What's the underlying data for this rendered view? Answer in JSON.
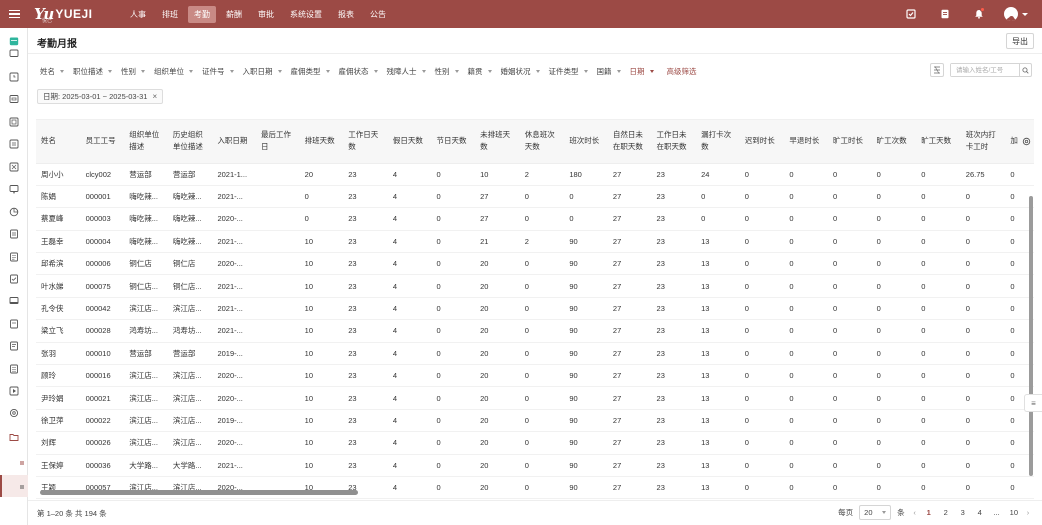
{
  "topbar": {
    "logo_mark": "Yu",
    "logo_text": "YUEJI",
    "logo_sub": "悦己",
    "nav": [
      {
        "label": "人事",
        "active": false
      },
      {
        "label": "排班",
        "active": false
      },
      {
        "label": "考勤",
        "active": true
      },
      {
        "label": "薪酬",
        "active": false
      },
      {
        "label": "审批",
        "active": false
      },
      {
        "label": "系统设置",
        "active": false
      },
      {
        "label": "报表",
        "active": false
      },
      {
        "label": "公告",
        "active": false
      }
    ],
    "accent": "#9c4a45"
  },
  "page": {
    "title": "考勤月报",
    "export_label": "导出"
  },
  "filters": {
    "items": [
      "姓名",
      "职位描述",
      "性别",
      "组织单位",
      "证件号",
      "入职日期",
      "雇佣类型",
      "雇佣状态",
      "残障人士",
      "性别",
      "籍贯",
      "婚姻状况",
      "证件类型",
      "国籍",
      "日期"
    ],
    "active_index": 14,
    "advanced_label": "高级筛选",
    "search_placeholder": "请输入姓名/工号"
  },
  "active_tag": "日期: 2025-03-01 ~ 2025-03-31",
  "table": {
    "columns": [
      "姓名",
      "员工工号",
      "组织单位描述",
      "历史组织单位描述",
      "入职日期",
      "最后工作日",
      "排班天数",
      "工作日天数",
      "假日天数",
      "节日天数",
      "未排班天数",
      "休息班次天数",
      "班次时长",
      "自然日未在职天数",
      "工作日未在职天数",
      "漏打卡次数",
      "迟到时长",
      "早退时长",
      "旷工时长",
      "旷工次数",
      "旷工天数",
      "班次内打卡工时",
      "加"
    ],
    "rows": [
      [
        "周小小",
        "clcy002",
        "营运部",
        "营运部",
        "2021-1...",
        "",
        "20",
        "23",
        "4",
        "0",
        "10",
        "2",
        "180",
        "27",
        "23",
        "24",
        "0",
        "0",
        "0",
        "0",
        "0",
        "26.75",
        "0"
      ],
      [
        "陈娟",
        "000001",
        "嗨吃辣...",
        "嗨吃辣...",
        "2021-...",
        "",
        "0",
        "23",
        "4",
        "0",
        "27",
        "0",
        "0",
        "27",
        "23",
        "0",
        "0",
        "0",
        "0",
        "0",
        "0",
        "0",
        "0"
      ],
      [
        "蔡夏峰",
        "000003",
        "嗨吃辣...",
        "嗨吃辣...",
        "2020-...",
        "",
        "0",
        "23",
        "4",
        "0",
        "27",
        "0",
        "0",
        "27",
        "23",
        "0",
        "0",
        "0",
        "0",
        "0",
        "0",
        "0",
        "0"
      ],
      [
        "王磊幸",
        "000004",
        "嗨吃辣...",
        "嗨吃辣...",
        "2021-...",
        "",
        "10",
        "23",
        "4",
        "0",
        "21",
        "2",
        "90",
        "27",
        "23",
        "13",
        "0",
        "0",
        "0",
        "0",
        "0",
        "0",
        "0"
      ],
      [
        "邱希滨",
        "000006",
        "铜仁店",
        "铜仁店",
        "2020-...",
        "",
        "10",
        "23",
        "4",
        "0",
        "20",
        "0",
        "90",
        "27",
        "23",
        "13",
        "0",
        "0",
        "0",
        "0",
        "0",
        "0",
        "0"
      ],
      [
        "叶水娣",
        "000075",
        "铜仁店...",
        "铜仁店...",
        "2021-...",
        "",
        "10",
        "23",
        "4",
        "0",
        "20",
        "0",
        "90",
        "27",
        "23",
        "13",
        "0",
        "0",
        "0",
        "0",
        "0",
        "0",
        "0"
      ],
      [
        "孔令侠",
        "000042",
        "滨江店...",
        "滨江店...",
        "2021-...",
        "",
        "10",
        "23",
        "4",
        "0",
        "20",
        "0",
        "90",
        "27",
        "23",
        "13",
        "0",
        "0",
        "0",
        "0",
        "0",
        "0",
        "0"
      ],
      [
        "梁立飞",
        "000028",
        "鸿寿坊...",
        "鸿寿坊...",
        "2021-...",
        "",
        "10",
        "23",
        "4",
        "0",
        "20",
        "0",
        "90",
        "27",
        "23",
        "13",
        "0",
        "0",
        "0",
        "0",
        "0",
        "0",
        "0"
      ],
      [
        "张羽",
        "000010",
        "营运部",
        "营运部",
        "2019-...",
        "",
        "10",
        "23",
        "4",
        "0",
        "20",
        "0",
        "90",
        "27",
        "23",
        "13",
        "0",
        "0",
        "0",
        "0",
        "0",
        "0",
        "0"
      ],
      [
        "顾玲",
        "000016",
        "滨江店...",
        "滨江店...",
        "2020-...",
        "",
        "10",
        "23",
        "4",
        "0",
        "20",
        "0",
        "90",
        "27",
        "23",
        "13",
        "0",
        "0",
        "0",
        "0",
        "0",
        "0",
        "0"
      ],
      [
        "尹玲娟",
        "000021",
        "滨江店...",
        "滨江店...",
        "2020-...",
        "",
        "10",
        "23",
        "4",
        "0",
        "20",
        "0",
        "90",
        "27",
        "23",
        "13",
        "0",
        "0",
        "0",
        "0",
        "0",
        "0",
        "0"
      ],
      [
        "徐卫萍",
        "000022",
        "滨江店...",
        "滨江店...",
        "2019-...",
        "",
        "10",
        "23",
        "4",
        "0",
        "20",
        "0",
        "90",
        "27",
        "23",
        "13",
        "0",
        "0",
        "0",
        "0",
        "0",
        "0",
        "0"
      ],
      [
        "刘辉",
        "000026",
        "滨江店...",
        "滨江店...",
        "2020-...",
        "",
        "10",
        "23",
        "4",
        "0",
        "20",
        "0",
        "90",
        "27",
        "23",
        "13",
        "0",
        "0",
        "0",
        "0",
        "0",
        "0",
        "0"
      ],
      [
        "王保婷",
        "000036",
        "大学路...",
        "大学路...",
        "2021-...",
        "",
        "10",
        "23",
        "4",
        "0",
        "20",
        "0",
        "90",
        "27",
        "23",
        "13",
        "0",
        "0",
        "0",
        "0",
        "0",
        "0",
        "0"
      ],
      [
        "王颖",
        "000057",
        "滨江店...",
        "滨江店...",
        "2020-...",
        "",
        "10",
        "23",
        "4",
        "0",
        "20",
        "0",
        "90",
        "27",
        "23",
        "13",
        "0",
        "0",
        "0",
        "0",
        "0",
        "0",
        "0"
      ]
    ]
  },
  "footer": {
    "total": "第 1–20 条  共 194 条",
    "per_page_label": "每页",
    "page_size": "20",
    "unit": "条",
    "prev": "‹",
    "pages": [
      "1",
      "2",
      "3",
      "4",
      "...",
      "10"
    ],
    "current_page": "1",
    "next": "›"
  },
  "icons": {
    "settings": "gear-icon",
    "handle": "≡"
  }
}
